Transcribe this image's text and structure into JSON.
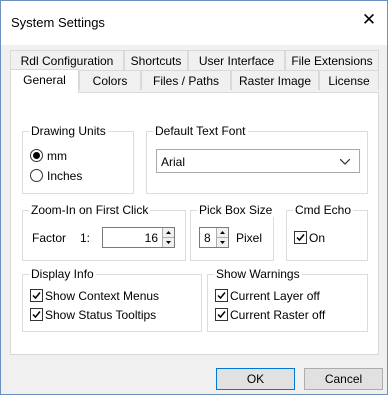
{
  "window": {
    "title": "System Settings",
    "close_glyph": "✕"
  },
  "tabs": {
    "row1": [
      "Rdl Configuration",
      "Shortcuts",
      "User Interface",
      "File Extensions"
    ],
    "row2": [
      "General",
      "Colors",
      "Files / Paths",
      "Raster Image",
      "License"
    ],
    "active": "General"
  },
  "drawing_units": {
    "label": "Drawing Units",
    "options": [
      {
        "label": "mm",
        "selected": true
      },
      {
        "label": "Inches",
        "selected": false
      }
    ]
  },
  "default_text_font": {
    "label": "Default Text Font",
    "value": "Arial"
  },
  "zoom_in": {
    "label": "Zoom-In on First Click",
    "factor_label": "Factor",
    "ratio_label": "1:",
    "value": "16"
  },
  "pick_box": {
    "label": "Pick Box Size",
    "value": "8",
    "unit": "Pixel"
  },
  "cmd_echo": {
    "label": "Cmd Echo",
    "option_label": "On",
    "checked": true
  },
  "display_info": {
    "label": "Display Info",
    "items": [
      {
        "label": "Show Context Menus",
        "checked": true
      },
      {
        "label": "Show Status Tooltips",
        "checked": true
      }
    ]
  },
  "show_warnings": {
    "label": "Show Warnings",
    "items": [
      {
        "label": "Current Layer off",
        "checked": true
      },
      {
        "label": "Current Raster off",
        "checked": true
      }
    ]
  },
  "buttons": {
    "ok": "OK",
    "cancel": "Cancel"
  },
  "colors": {
    "window_border": "#6b8fbf",
    "default_button_border": "#0078d7"
  }
}
